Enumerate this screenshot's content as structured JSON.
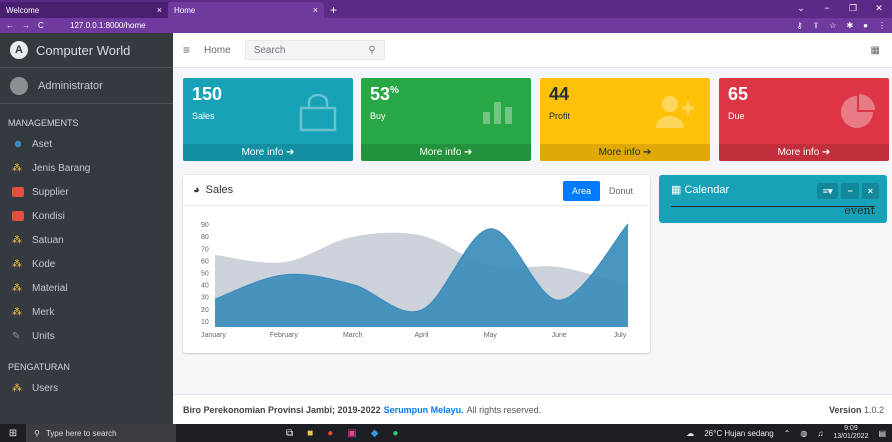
{
  "browser": {
    "tabs": [
      {
        "title": "Welcome",
        "close": "×"
      },
      {
        "title": "Home",
        "close": "×"
      }
    ],
    "new_tab": "+",
    "url": "127.0.0.1:8000/home"
  },
  "sidebar": {
    "brand": "Computer World",
    "user": "Administrator",
    "sections": [
      {
        "title": "MANAGEMENTS"
      },
      {
        "title": "PENGATURAN"
      }
    ],
    "items": [
      {
        "label": "Aset",
        "icon": "aset-icon"
      },
      {
        "label": "Jenis Barang",
        "icon": "people-icon"
      },
      {
        "label": "Supplier",
        "icon": "truck-icon"
      },
      {
        "label": "Kondisi",
        "icon": "truck-icon"
      },
      {
        "label": "Satuan",
        "icon": "people-icon"
      },
      {
        "label": "Kode",
        "icon": "people-icon"
      },
      {
        "label": "Material",
        "icon": "people-icon"
      },
      {
        "label": "Merk",
        "icon": "people-icon"
      },
      {
        "label": "Units",
        "icon": "ruler-icon"
      },
      {
        "label": "Users",
        "icon": "users-icon"
      }
    ]
  },
  "topnav": {
    "home": "Home",
    "search_placeholder": "Search"
  },
  "info_boxes": [
    {
      "value": "150",
      "sup": "",
      "label": "Sales",
      "more": "More info ➔",
      "color": "#17a2b8"
    },
    {
      "value": "53",
      "sup": "%",
      "label": "Buy",
      "more": "More info ➔",
      "color": "#28a745"
    },
    {
      "value": "44",
      "sup": "",
      "label": "Profit",
      "more": "More info ➔",
      "color": "#ffc107"
    },
    {
      "value": "65",
      "sup": "",
      "label": "Due",
      "more": "More info ➔",
      "color": "#dc3545"
    }
  ],
  "sales_card": {
    "title": "Sales",
    "tabs": [
      "Area",
      "Donut"
    ],
    "active_tab": "Area"
  },
  "chart_data": {
    "type": "area",
    "title": "",
    "categories": [
      "January",
      "February",
      "March",
      "April",
      "May",
      "June",
      "July"
    ],
    "yticks": [
      10,
      20,
      30,
      40,
      50,
      60,
      70,
      80,
      90
    ],
    "ylim": [
      5,
      95
    ],
    "series": [
      {
        "values": [
          65,
          59,
          80,
          81,
          56,
          55,
          40
        ],
        "color": "#c9cfd8"
      },
      {
        "values": [
          28,
          48,
          40,
          19,
          86,
          27,
          90
        ],
        "color": "#3c8dbc"
      }
    ]
  },
  "calendar": {
    "title": "Calendar",
    "menu": "≡▾",
    "minimize": "−",
    "close": "×",
    "event": "event"
  },
  "footer": {
    "text": "Biro Perekonomian Provinsi Jambi; 2019-2022",
    "link": "Serumpun Melayu.",
    "rights": "All rights reserved.",
    "version_label": "Version",
    "version": "1.0.2"
  },
  "taskbar": {
    "search_placeholder": "Type here to search",
    "weather": "26°C  Hujan sedang",
    "time": "9:09",
    "date": "13/01/2022"
  }
}
